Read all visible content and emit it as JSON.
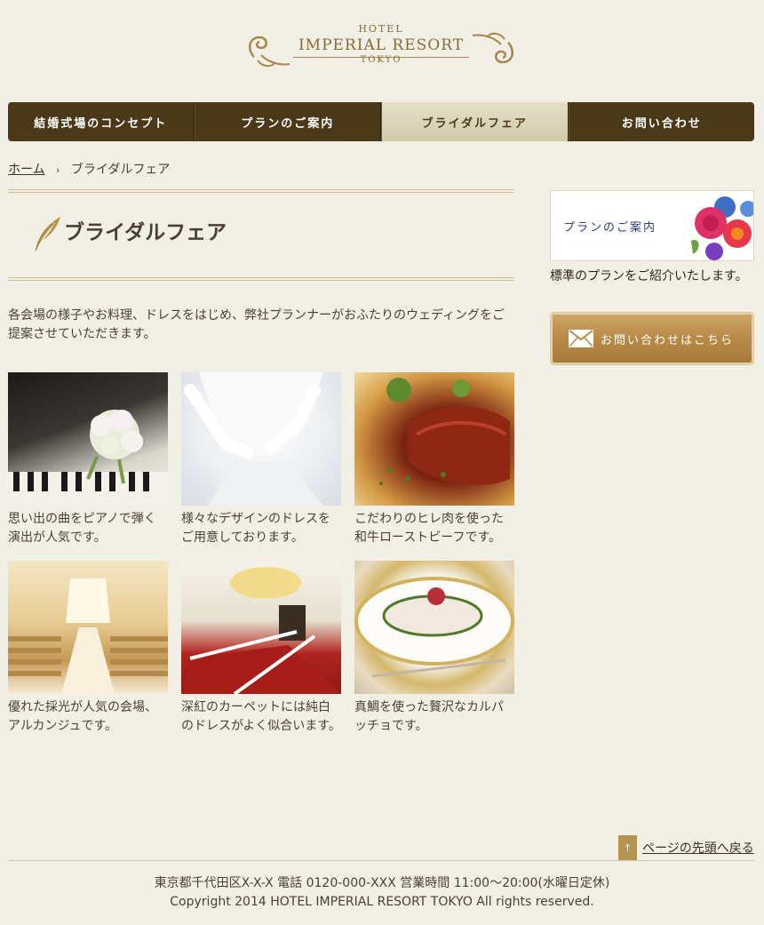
{
  "logo": {
    "hotel": "HOTEL",
    "name": "IMPERIAL RESORT",
    "city": "TOKYO"
  },
  "nav": {
    "items": [
      {
        "label": "結婚式場のコンセプト",
        "active": false
      },
      {
        "label": "プランのご案内",
        "active": false
      },
      {
        "label": "ブライダルフェア",
        "active": true
      },
      {
        "label": "お問い合わせ",
        "active": false
      }
    ]
  },
  "breadcrumb": {
    "home": "ホーム",
    "separator": "›",
    "current": "ブライダルフェア"
  },
  "page": {
    "title": "ブライダルフェア",
    "intro": "各会場の様子やお料理、ドレスをはじめ、弊社プランナーがおふたりのウェディングをご提案させていただきます。"
  },
  "gallery": [
    {
      "caption": "思い出の曲をピアノで弾く演出が人気です。"
    },
    {
      "caption": "様々なデザインのドレスをご用意しております。"
    },
    {
      "caption": "こだわりのヒレ肉を使った和牛ローストビーフです。"
    },
    {
      "caption": "優れた採光が人気の会場、アルカンジュです。"
    },
    {
      "caption": "深紅のカーペットには純白のドレスがよく似合います。"
    },
    {
      "caption": "真鯛を使った贅沢なカルパッチョです。"
    }
  ],
  "sidebar": {
    "banner_label": "プランのご案内",
    "banner_desc": "標準のプランをご紹介いたします。",
    "contact_label": "お問い合わせはこちら"
  },
  "footer": {
    "totop_icon": "↑",
    "totop": "ページの先頭へ戻る",
    "address": "東京都千代田区X-X-X 電話 0120-000-XXX 営業時間 11:00～20:00(水曜日定休)",
    "copyright": "Copyright 2014 HOTEL IMPERIAL RESORT TOKYO All rights reserved."
  },
  "colors": {
    "background": "#f2f0e6",
    "nav": "#4a3918",
    "nav_active": "#dcd5b9",
    "accent_gold": "#b88a47"
  }
}
